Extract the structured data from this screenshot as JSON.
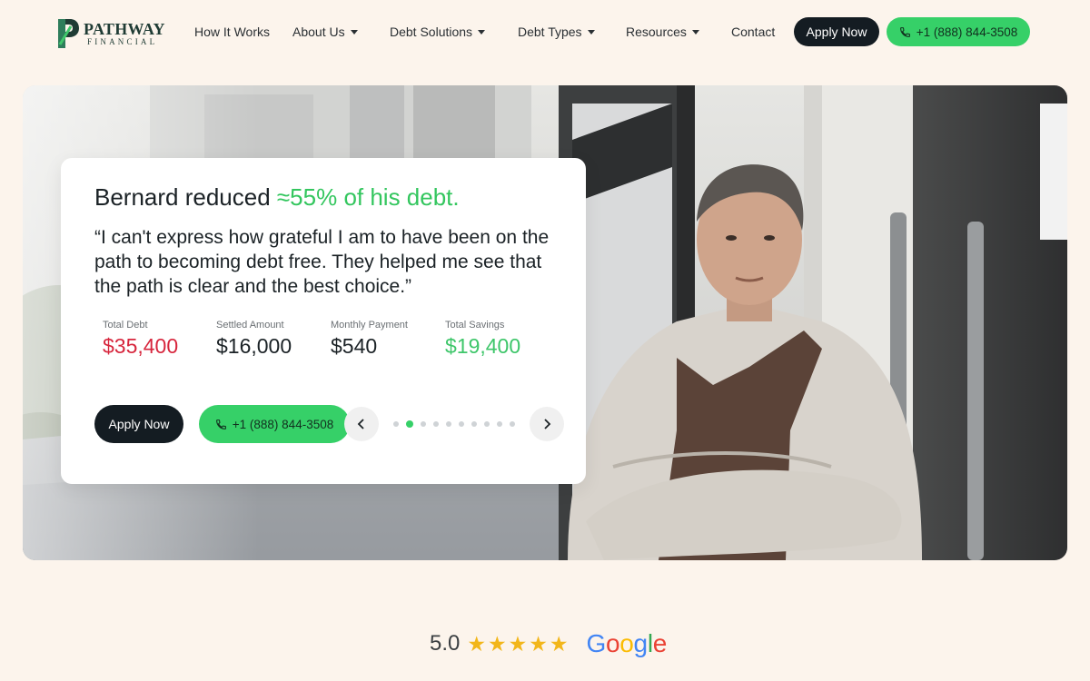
{
  "brand": {
    "name": "PATHWAY",
    "subtitle": "FINANCIAL",
    "colors": {
      "accent": "#36d068",
      "dark": "#141c22",
      "background": "#fcf4ec"
    }
  },
  "nav": {
    "items": [
      {
        "label": "How It Works",
        "has_dropdown": false
      },
      {
        "label": "About Us",
        "has_dropdown": true
      },
      {
        "label": "Debt Solutions",
        "has_dropdown": true
      },
      {
        "label": "Debt Types",
        "has_dropdown": true
      },
      {
        "label": "Resources",
        "has_dropdown": true
      },
      {
        "label": "Contact",
        "has_dropdown": false
      }
    ],
    "apply_label": "Apply Now",
    "phone_label": "+1 (888) 844-3508"
  },
  "hero": {
    "title_prefix": "Bernard reduced ",
    "title_highlight": "≈55% of his debt.",
    "quote": "“I can't express how grateful I am to have been on the path to becoming debt free. They helped me see that the path is clear and the best choice.”",
    "stats": [
      {
        "label": "Total Debt",
        "value": "$35,400",
        "tone": "red"
      },
      {
        "label": "Settled Amount",
        "value": "$16,000",
        "tone": "dark"
      },
      {
        "label": "Monthly Payment",
        "value": "$540",
        "tone": "dark"
      },
      {
        "label": "Total Savings",
        "value": "$19,400",
        "tone": "green"
      }
    ],
    "apply_label": "Apply Now",
    "phone_label": "+1 (888) 844-3508",
    "carousel": {
      "total_slides": 10,
      "active_index": 1
    }
  },
  "rating": {
    "score": "5.0",
    "stars": 5,
    "provider": {
      "G": "G",
      "o1": "o",
      "o2": "o",
      "g": "g",
      "l": "l",
      "e": "e"
    }
  }
}
